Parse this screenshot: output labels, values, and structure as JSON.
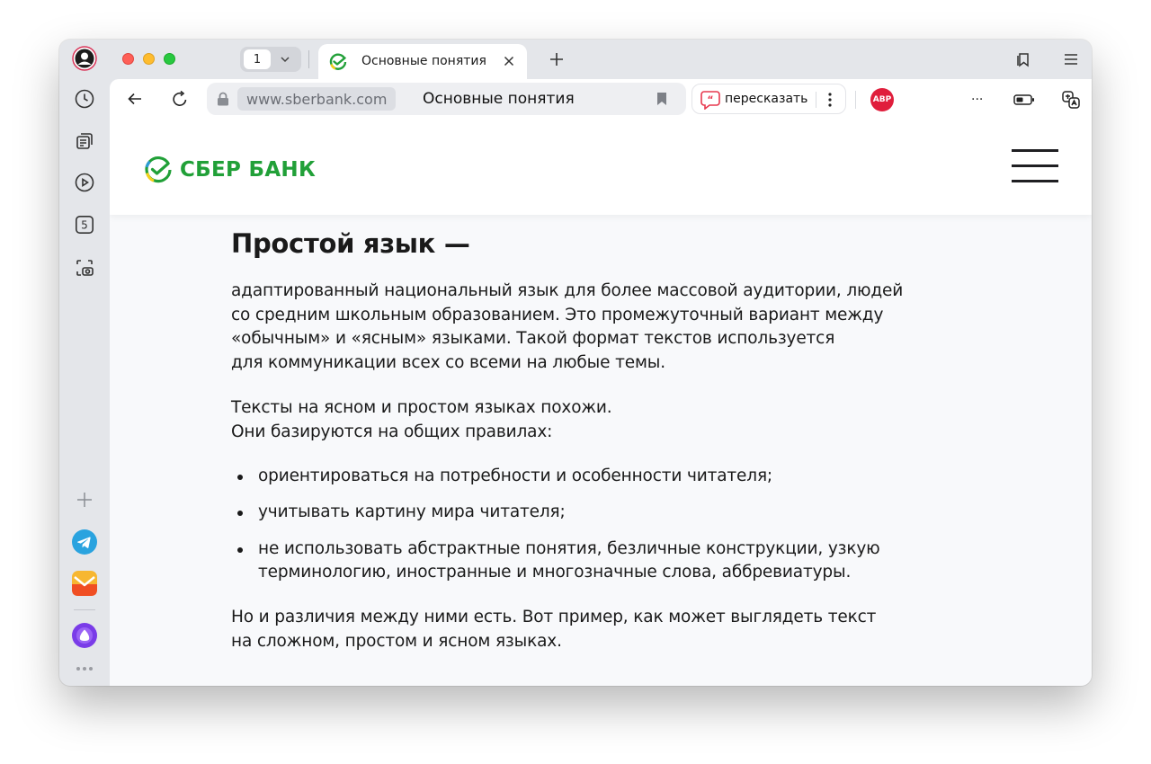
{
  "window": {
    "tab_count": "1",
    "active_tab": {
      "title": "Основные понятия"
    }
  },
  "toolbar": {
    "url_domain": "www.sberbank.com",
    "page_title": "Основные понятия",
    "retell_label": "пересказать",
    "abp_label": "ABP",
    "extensions_more": "..."
  },
  "sidebar": {
    "items": [
      {
        "name": "profile-avatar"
      },
      {
        "name": "history-icon"
      },
      {
        "name": "collections-icon"
      },
      {
        "name": "video-icon"
      },
      {
        "name": "counter",
        "label": "5"
      },
      {
        "name": "screenshot-icon"
      },
      {
        "name": "add-panel-icon"
      },
      {
        "name": "telegram-icon"
      },
      {
        "name": "mail-icon"
      },
      {
        "name": "alice-icon"
      },
      {
        "name": "more-icon"
      }
    ]
  },
  "site": {
    "logo_text": "СБЕР БАНК",
    "colors": {
      "brand": "#21a038",
      "accent_yellow": "#f5d11b",
      "accent_blue": "#2d9bd6"
    }
  },
  "article": {
    "heading": "Простой язык —",
    "p1": [
      "адаптированный национальный язык для более массовой аудитории, людей",
      "со средним школьным образованием. Это промежуточный вариант между",
      "«обычным» и «ясным» языками. Такой формат текстов используется",
      "для коммуникации всех со всеми на любые темы."
    ],
    "p2": [
      "Тексты на ясном и простом языках похожи.",
      "Они базируются на общих правилах:"
    ],
    "bullets": [
      [
        "ориентироваться на потребности и особенности читателя;"
      ],
      [
        "учитывать картину мира читателя;"
      ],
      [
        "не использовать абстрактные понятия, безличные конструкции, узкую",
        "терминологию, иностранные и многозначные слова, аббревиатуры."
      ]
    ],
    "p3": [
      "Но и различия между ними есть. Вот пример, как может выглядеть текст",
      "на сложном, простом и ясном языках."
    ]
  }
}
